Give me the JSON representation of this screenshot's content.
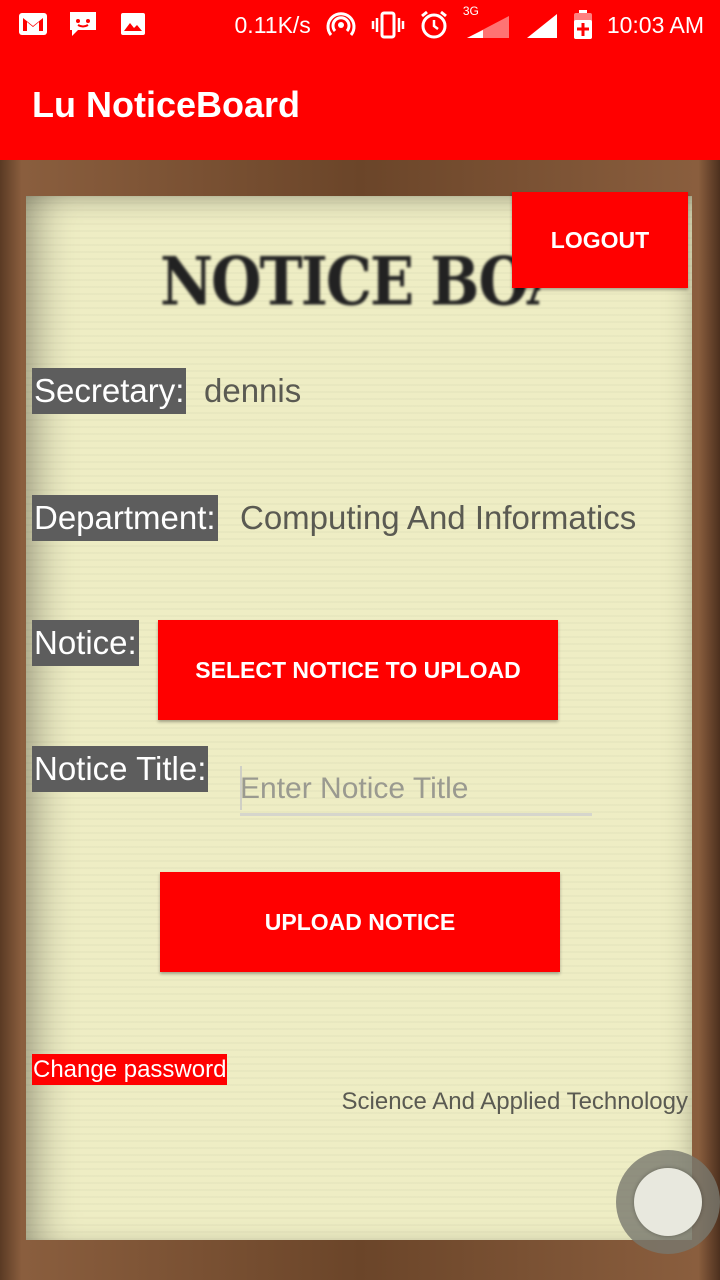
{
  "status_bar": {
    "net_speed": "0.11K/s",
    "network_type": "3G",
    "time": "10:03 AM",
    "icons": [
      "gmail-icon",
      "message-icon",
      "image-icon",
      "hotspot-icon",
      "vibrate-icon",
      "alarm-icon",
      "signal-icon",
      "battery-icon"
    ]
  },
  "app_bar": {
    "title": "Lu NoticeBoard"
  },
  "board": {
    "header_image_text": "NOTICE BOARD",
    "logout_label": "LOGOUT",
    "secretary_label": "Secretary:",
    "secretary_value": "dennis",
    "department_label": "Department:",
    "department_value": "Computing And Informatics",
    "notice_label": "Notice:",
    "select_notice_label": "SELECT NOTICE TO UPLOAD",
    "notice_title_label": "Notice Title:",
    "notice_title_placeholder": "Enter Notice Title",
    "notice_title_value": "",
    "upload_label": "UPLOAD NOTICE",
    "change_password_label": "Change password",
    "faculty_text": "Science And Applied Technology"
  },
  "colors": {
    "accent": "#ff0000",
    "paper": "#eeedc4",
    "label_bg": "#5d5d5d"
  }
}
